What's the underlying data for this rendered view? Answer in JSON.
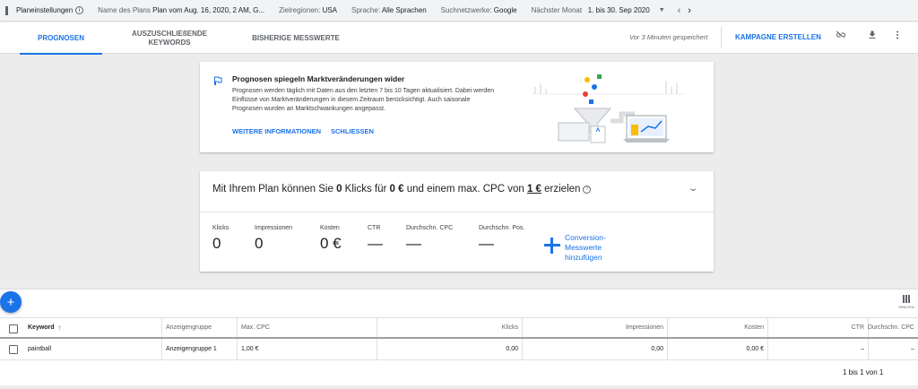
{
  "topbar": {
    "plan_settings": "Planeinstellungen",
    "plan_name_label": "Name des Plans",
    "plan_name_value": "Plan vom Aug. 16, 2020, 2 AM, G...",
    "regions_label": "Zielregionen:",
    "regions_value": "USA",
    "language_label": "Sprache:",
    "language_value": "Alle Sprachen",
    "network_label": "Suchnetzwerke:",
    "network_value": "Google",
    "period_label": "Nächster Monat",
    "period_value": "1. bis 30. Sep 2020"
  },
  "tabs": [
    {
      "label": "PROGNOSEN"
    },
    {
      "label": "AUSZUSCHLIEßENDE KEYWORDS"
    },
    {
      "label": "BISHERIGE MESSWERTE"
    }
  ],
  "header": {
    "saved_text": "Vor 3 Minuten gespeichert",
    "create_campaign": "KAMPAGNE ERSTELLEN"
  },
  "info_card": {
    "title": "Prognosen spiegeln Marktveränderungen wider",
    "body": "Prognosen werden täglich mit Daten aus den letzten 7 bis 10 Tagen aktualisiert. Dabei werden Einflüsse von Marktveränderungen in diesem Zeitraum berücksichtigt. Auch saisonale Prognosen wurden an Marktschwankungen angepasst.",
    "more_info": "WEITERE INFORMATIONEN",
    "close": "SCHLIESSEN"
  },
  "forecast_card": {
    "head_1": "Mit Ihrem Plan können Sie ",
    "clicks": "0",
    "head_2": " Klicks für ",
    "cost": "0 €",
    "head_3": " und einem max. CPC von ",
    "max_cpc": "1 €",
    "head_4": " erzielen",
    "metrics": [
      {
        "label": "Klicks",
        "value": "0"
      },
      {
        "label": "Impressionen",
        "value": "0"
      },
      {
        "label": "Kosten",
        "value": "0 €"
      },
      {
        "label": "CTR",
        "value": "—"
      },
      {
        "label": "Durchschn. CPC",
        "value": "—"
      },
      {
        "label": "Durchschn. Pos.",
        "value": "—"
      }
    ],
    "add_conversion": "Conversion-Messwerte hinzufügen"
  },
  "table": {
    "columns_label": "SPALTEN",
    "headers": [
      "Keyword",
      "Anzeigengruppe",
      "Max. CPC",
      "Klicks",
      "Impressionen",
      "Kosten",
      "CTR",
      "Durchschn. CPC"
    ],
    "rows": [
      [
        "paintball",
        "Anzeigengruppe 1",
        "1,00 €",
        "0,00",
        "0,00",
        "0,00 €",
        "–",
        "–"
      ]
    ],
    "pagination": "1 bis 1 von 1"
  }
}
